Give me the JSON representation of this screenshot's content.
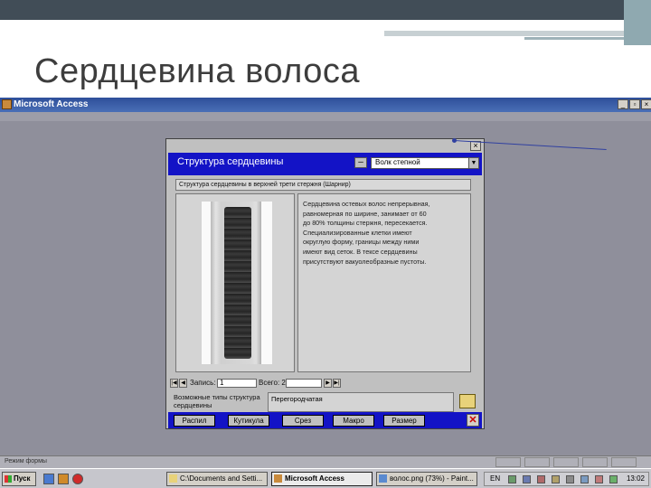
{
  "slide": {
    "title": "Сердцевина волоса"
  },
  "app": {
    "title": "Microsoft Access",
    "window_buttons": [
      "_",
      "▫",
      "×"
    ]
  },
  "dialog": {
    "close": "×",
    "heading": "Структура сердцевины",
    "combo_minus": "–",
    "species_value": "Волк степной",
    "combo_arrow": "▼",
    "subtitle": "Структура сердцевины в верхней трети стержня (Шарнир)",
    "description": "Сердцевина остевых волос непрерывная,\nравномерная по ширине, занимает от 60\nдо 80% толщины стержня, пересекается.\nСпециализированные клетки имеют\nокруглую форму, границы между ними\nимеют вид сеток. В тексе сердцевины\nприсутствуют вакуолеобразные пустоты.",
    "nav": {
      "record_label": "Запись:",
      "record_value": "1",
      "total_label": "Всего: 2",
      "first": "|◀",
      "prev": "◀",
      "next": "▶",
      "last": "▶|"
    },
    "bottom_label": "Возможные типы структура сердцевины",
    "bottom_value": "Перегородчатая",
    "buttons": [
      "Распил",
      "Кутикула",
      "Срез",
      "Макро",
      "Размер"
    ]
  },
  "status": {
    "text": "Режим формы"
  },
  "taskbar": {
    "start": "Пуск",
    "tasks": [
      "C:\\Documents and Setti...",
      "Microsoft Access",
      "волос.png (73%) - Paint..."
    ],
    "lang": "EN",
    "time": "13:02"
  },
  "colors": {
    "dialog_blue": "#1313c6",
    "slide_header": "#414d57",
    "title_text": "#3d3d3d"
  }
}
